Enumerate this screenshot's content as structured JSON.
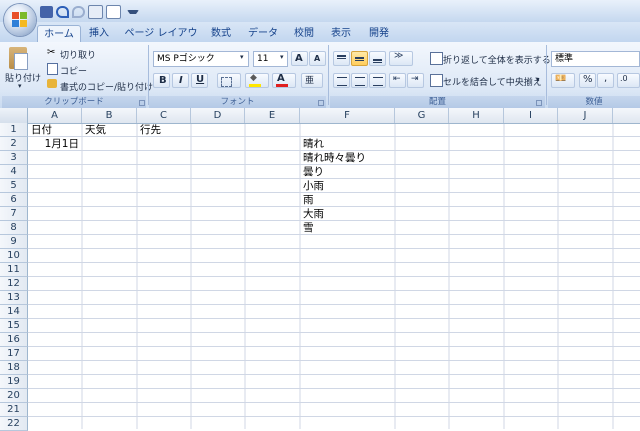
{
  "tabs": [
    "ホーム",
    "挿入",
    "ページ レイアウト",
    "数式",
    "データ",
    "校閲",
    "表示",
    "開発"
  ],
  "clipboard": {
    "paste_label": "貼り付け",
    "cut_label": "切り取り",
    "copy_label": "コピー",
    "format_painter_label": "書式のコピー/貼り付け",
    "group_label": "クリップボード"
  },
  "font": {
    "font_name": "MS Pゴシック",
    "font_size": "11",
    "group_label": "フォント"
  },
  "alignment": {
    "wrap_text_label": "折り返して全体を表示する",
    "merge_center_label": "セルを結合して中央揃え",
    "group_label": "配置"
  },
  "number": {
    "format_value": "標準",
    "group_label": "数値"
  },
  "columns": [
    "A",
    "B",
    "C",
    "D",
    "E",
    "F",
    "G",
    "H",
    "I",
    "J"
  ],
  "rows": [
    "1",
    "2",
    "3",
    "4",
    "5",
    "6",
    "7",
    "8",
    "9",
    "10",
    "11",
    "12",
    "13",
    "14",
    "15",
    "16",
    "17",
    "18",
    "19",
    "20",
    "21",
    "22"
  ],
  "cells": {
    "A1": "日付",
    "B1": "天気",
    "C1": "行先",
    "A2": "1月1日",
    "F2": "晴れ",
    "F3": "晴れ時々曇り",
    "F4": "曇り",
    "F5": "小雨",
    "F6": "雨",
    "F7": "大雨",
    "F8": "雪"
  },
  "colors": {
    "tab_text": "#15428b",
    "ribbon_bg": "#dde8f6",
    "header_bg": "#e2e9f2",
    "gridline": "#d0d7e5"
  }
}
